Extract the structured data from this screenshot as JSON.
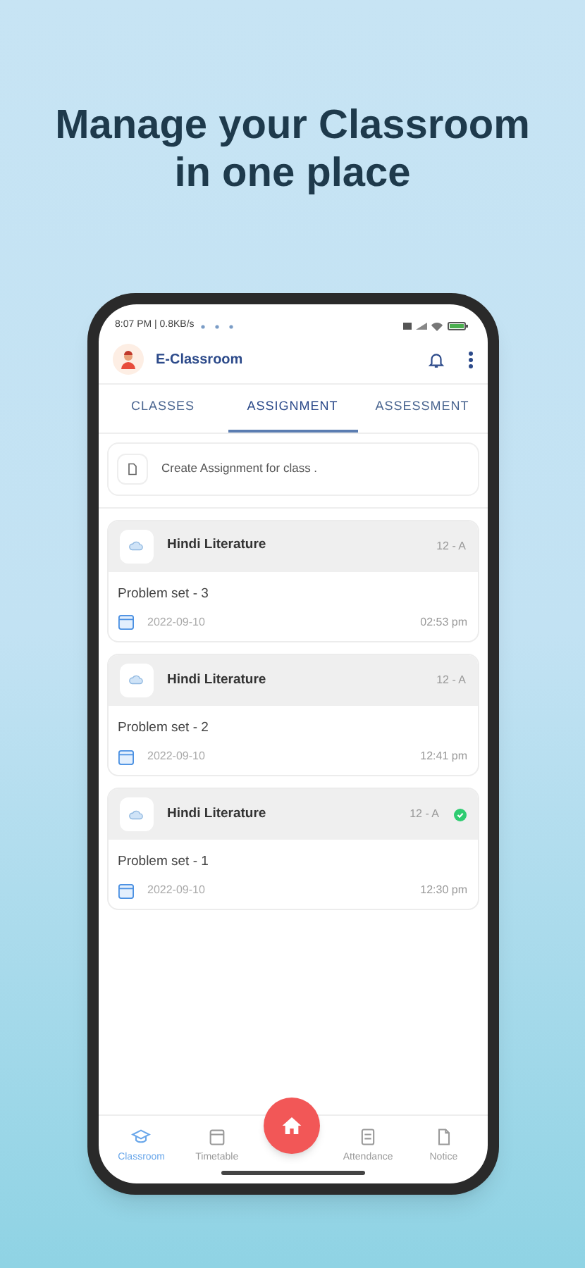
{
  "headline": "Manage your Classroom in one place",
  "status_bar": {
    "time": "8:07 PM | 0.8KB/s"
  },
  "app_bar": {
    "title": "E-Classroom"
  },
  "tabs": [
    {
      "label": "CLASSES",
      "selected": false
    },
    {
      "label": "ASSIGNMENT",
      "selected": true
    },
    {
      "label": "ASSESSMENT",
      "selected": false
    }
  ],
  "create_prompt": "Create Assignment for class .",
  "assignments": [
    {
      "subject": "Hindi Literature",
      "class": "12 - A",
      "title": "Problem set - 3",
      "date": "2022-09-10",
      "time": "02:53 pm",
      "done": false
    },
    {
      "subject": "Hindi Literature",
      "class": "12 - A",
      "title": "Problem set - 2",
      "date": "2022-09-10",
      "time": "12:41 pm",
      "done": false
    },
    {
      "subject": "Hindi Literature",
      "class": "12 - A",
      "title": "Problem set - 1",
      "date": "2022-09-10",
      "time": "12:30 pm",
      "done": true
    }
  ],
  "bottom_nav": [
    {
      "kind": "classroom",
      "label": "Classroom",
      "selected": true
    },
    {
      "kind": "timetable",
      "label": "Timetable",
      "selected": false
    },
    {
      "kind": "home",
      "selected": false
    },
    {
      "kind": "attendance",
      "label": "Attendance",
      "selected": false
    },
    {
      "kind": "notice",
      "label": "Notice",
      "selected": false
    }
  ]
}
